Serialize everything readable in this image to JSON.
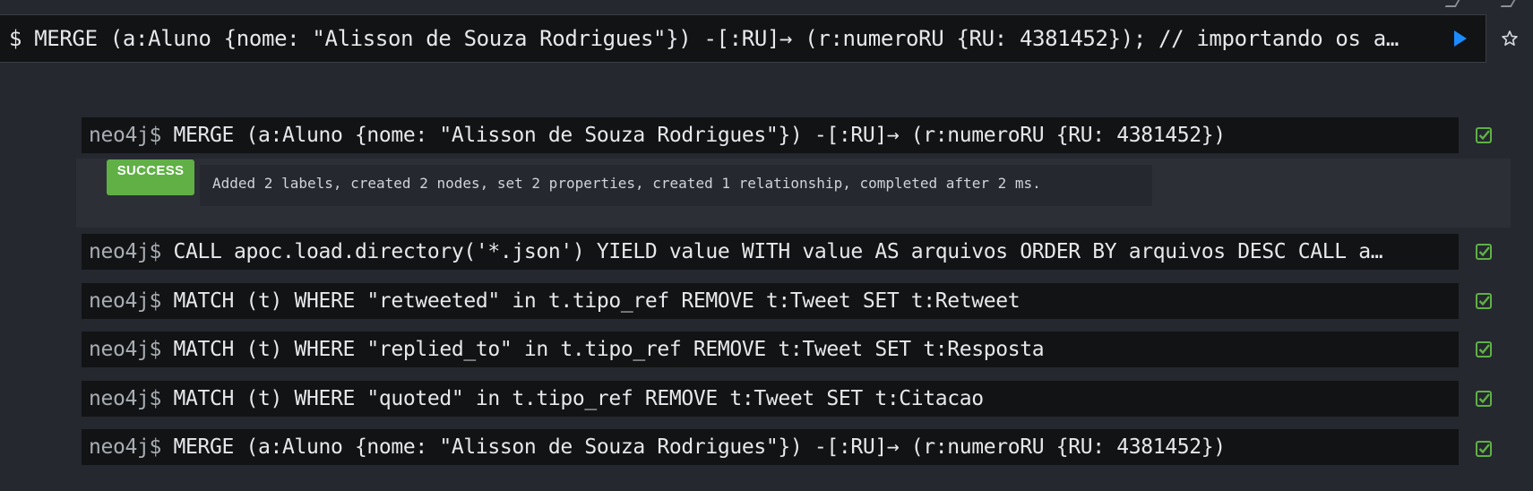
{
  "editor": {
    "query": "$ MERGE (a:Aluno {nome: \"Alisson de Souza Rodrigues\"}) -[:RU]→ (r:numeroRU {RU: 4381452}); // importando os a…",
    "run_icon": "play-icon",
    "favorite_icon": "star-icon"
  },
  "prompt": "neo4j$",
  "frames": [
    {
      "command": " MERGE (a:Aluno {nome: \"Alisson de Souza Rodrigues\"}) -[:RU]→ (r:numeroRU {RU: 4381452})",
      "status_icon": "check-square-icon",
      "status_color": "#60b046"
    },
    {
      "command": " CALL apoc.load.directory('*.json') YIELD value WITH value AS arquivos ORDER BY arquivos DESC CALL a…",
      "status_icon": "check-square-icon",
      "status_color": "#60b046"
    },
    {
      "command": " MATCH (t) WHERE \"retweeted\" in t.tipo_ref REMOVE t:Tweet SET t:Retweet",
      "status_icon": "check-square-icon",
      "status_color": "#60b046"
    },
    {
      "command": " MATCH (t) WHERE \"replied_to\" in t.tipo_ref REMOVE t:Tweet SET t:Resposta",
      "status_icon": "check-square-icon",
      "status_color": "#60b046"
    },
    {
      "command": " MATCH (t) WHERE \"quoted\" in t.tipo_ref REMOVE t:Tweet SET t:Citacao",
      "status_icon": "check-square-icon",
      "status_color": "#60b046"
    },
    {
      "command": " MERGE (a:Aluno {nome: \"Alisson de Souza Rodrigues\"}) -[:RU]→ (r:numeroRU {RU: 4381452})",
      "status_icon": "check-square-icon",
      "status_color": "#60b046"
    }
  ],
  "result": {
    "badge": "SUCCESS",
    "badge_color": "#60b046",
    "message": "Added 2 labels, created 2 nodes, set 2 properties, created 1 relationship, completed after 2 ms."
  },
  "colors": {
    "background": "#25282f",
    "frame_background": "#121314",
    "run_button": "#1a8cff"
  }
}
